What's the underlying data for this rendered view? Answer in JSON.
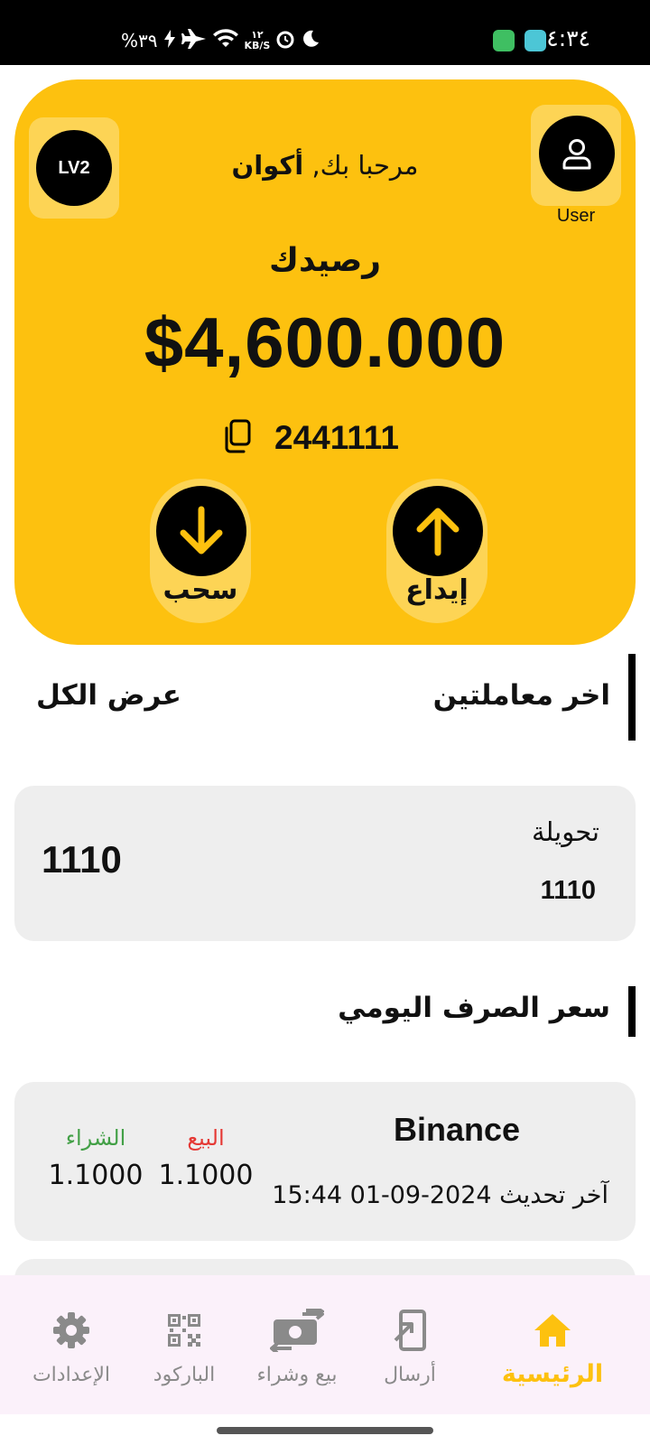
{
  "status_bar": {
    "time": "٤:٣٤",
    "battery": "%٣٩",
    "network_speed_value": "١٢",
    "network_speed_unit": "KB/S"
  },
  "header": {
    "level_badge": "LV2",
    "user_label": "User",
    "greeting_prefix": "مرحبا بك,",
    "greeting_name": "أكوان"
  },
  "balance": {
    "label": "رصيدك",
    "amount": "$4,600.000",
    "account_number": "2441111"
  },
  "actions": {
    "withdraw_label": "سحب",
    "deposit_label": "إيداع"
  },
  "transactions": {
    "title": "اخر معاملتين",
    "view_all": "عرض الكل",
    "items": [
      {
        "type": "تحويلة",
        "reference": "1110",
        "amount": "1110"
      }
    ]
  },
  "exchange": {
    "title": "سعر الصرف اليومي",
    "items": [
      {
        "name": "Binance",
        "updated_label": "آخر تحديث",
        "updated_at": "15:44 01-09-2024",
        "sell_label": "البيع",
        "sell_value": "1.1000",
        "buy_label": "الشراء",
        "buy_value": "1.1000"
      }
    ]
  },
  "bottom_nav": {
    "home": "الرئيسية",
    "send": "أرسال",
    "buy_sell": "بيع وشراء",
    "barcode": "الباركود",
    "settings": "الإعدادات"
  },
  "colors": {
    "accent": "#fdc10f",
    "sell": "#e53935",
    "buy": "#43a047"
  }
}
